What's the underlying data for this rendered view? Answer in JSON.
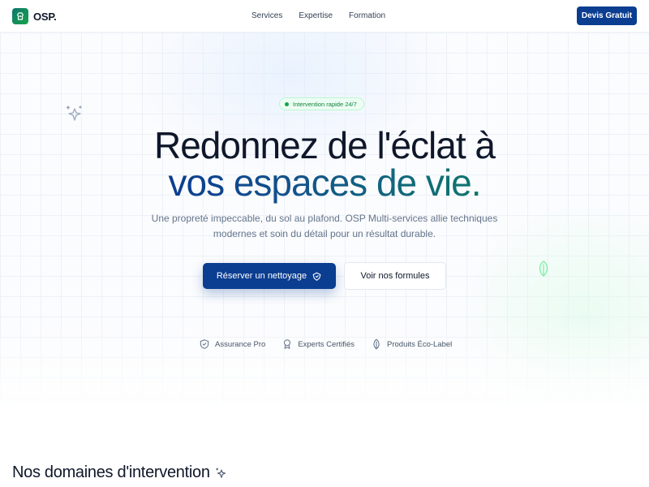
{
  "brand": {
    "name": "OSP."
  },
  "nav": {
    "links": [
      "Services",
      "Expertise",
      "Formation"
    ],
    "cta_label": "Devis Gratuit"
  },
  "hero": {
    "badge": "Intervention rapide 24/7",
    "title_line1": "Redonnez de l'éclat à",
    "title_line2": "vos espaces de vie.",
    "subtitle": "Une propreté impeccable, du sol au plafond. OSP Multi-services allie techniques modernes et soin du détail pour un résultat durable.",
    "primary_button": "Réserver un nettoyage",
    "secondary_button": "Voir nos formules",
    "trust_items": [
      {
        "label": "Assurance Pro",
        "icon": "shield-check-icon"
      },
      {
        "label": "Experts Certifiés",
        "icon": "award-icon"
      },
      {
        "label": "Produits Éco-Label",
        "icon": "leaf-icon"
      }
    ]
  },
  "section": {
    "title": "Nos domaines d'intervention",
    "icon": "sparkle-icon"
  },
  "colors": {
    "primary": "#0b3d91",
    "accent_green": "#16a34a",
    "teal": "#0f766e",
    "text": "#0f172a",
    "muted": "#64748b"
  }
}
